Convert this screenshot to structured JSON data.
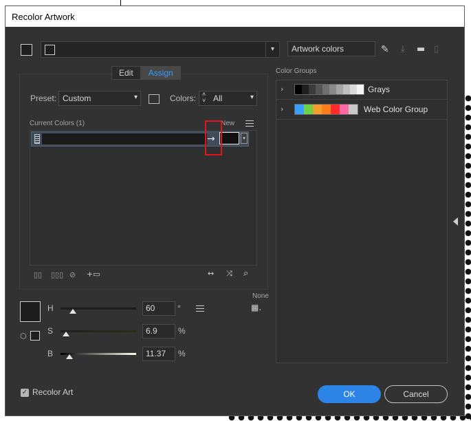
{
  "dialog": {
    "title": "Recolor Artwork"
  },
  "top": {
    "artwork_colors_value": "Artwork colors"
  },
  "tabs": [
    {
      "label": "Edit"
    },
    {
      "label": "Assign"
    }
  ],
  "preset": {
    "label": "Preset:",
    "value": "Custom"
  },
  "colors": {
    "label": "Colors:",
    "value": "All"
  },
  "current_colors": {
    "header": "Current Colors (1)",
    "new_label": "New"
  },
  "color_groups": {
    "header": "Color Groups",
    "groups": [
      {
        "name": "Grays",
        "swatches": [
          "#000000",
          "#1f1f1f",
          "#3a3a3a",
          "#555555",
          "#707070",
          "#8a8a8a",
          "#a5a5a5",
          "#c0c0c0",
          "#dadada",
          "#f5f5f5"
        ]
      },
      {
        "name": "Web Color Group",
        "swatches": [
          "#3aa0ff",
          "#6fd04a",
          "#f2a02c",
          "#ff7c1f",
          "#ff2a2a",
          "#ff6aa6",
          "#c8c8c8"
        ]
      }
    ]
  },
  "hsb": {
    "none_label": "None",
    "h": {
      "label": "H",
      "value": "60",
      "unit": "°"
    },
    "s": {
      "label": "S",
      "value": "6.9",
      "unit": "%"
    },
    "b": {
      "label": "B",
      "value": "11.37",
      "unit": "%"
    }
  },
  "footer": {
    "recolor_art_label": "Recolor Art",
    "recolor_art_checked": true,
    "ok_label": "OK",
    "cancel_label": "Cancel"
  },
  "colors_palette": {
    "accent": "#2c85e6",
    "tab_active": "#3a9cff",
    "dialog_bg": "#323232",
    "highlight": "#e0161c"
  }
}
